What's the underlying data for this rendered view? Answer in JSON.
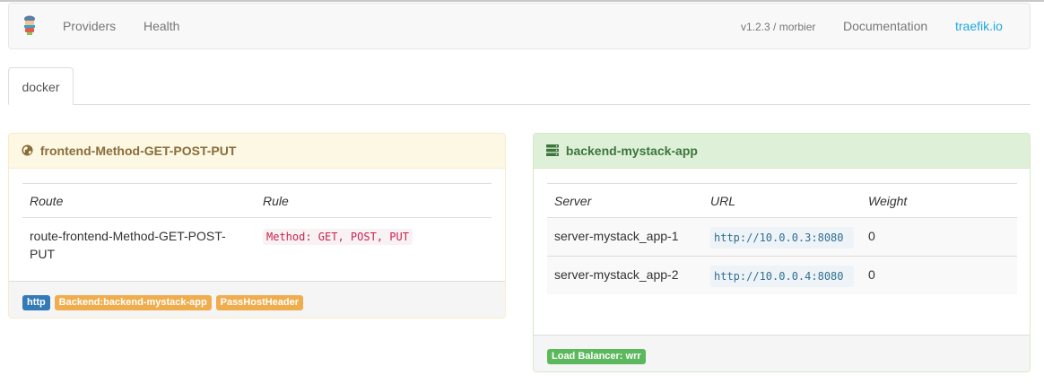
{
  "nav": {
    "links": [
      "Providers",
      "Health"
    ],
    "version": "v1.2.3 / morbier",
    "documentation": "Documentation",
    "site": "traefik.io"
  },
  "tabs": [
    {
      "label": "docker",
      "active": true
    }
  ],
  "frontend": {
    "title": "frontend-Method-GET-POST-PUT",
    "columns": [
      "Route",
      "Rule"
    ],
    "rows": [
      {
        "route": "route-frontend-Method-GET-POST-PUT",
        "rule": "Method: GET, POST, PUT"
      }
    ],
    "labels": [
      "http",
      "Backend:backend-mystack-app",
      "PassHostHeader"
    ]
  },
  "backend": {
    "title": "backend-mystack-app",
    "columns": [
      "Server",
      "URL",
      "Weight"
    ],
    "rows": [
      {
        "server": "server-mystack_app-1",
        "url": "http://10.0.0.3:8080",
        "weight": "0"
      },
      {
        "server": "server-mystack_app-2",
        "url": "http://10.0.0.4:8080",
        "weight": "0"
      }
    ],
    "labels": [
      "Load Balancer: wrr"
    ]
  },
  "colors": {
    "accent": "#1fa9e0",
    "frontend_heading": "#8a6d3b",
    "backend_heading": "#3c763d",
    "label_primary": "#337ab7",
    "label_warning": "#f0ad4e",
    "label_success": "#5cb85c"
  }
}
